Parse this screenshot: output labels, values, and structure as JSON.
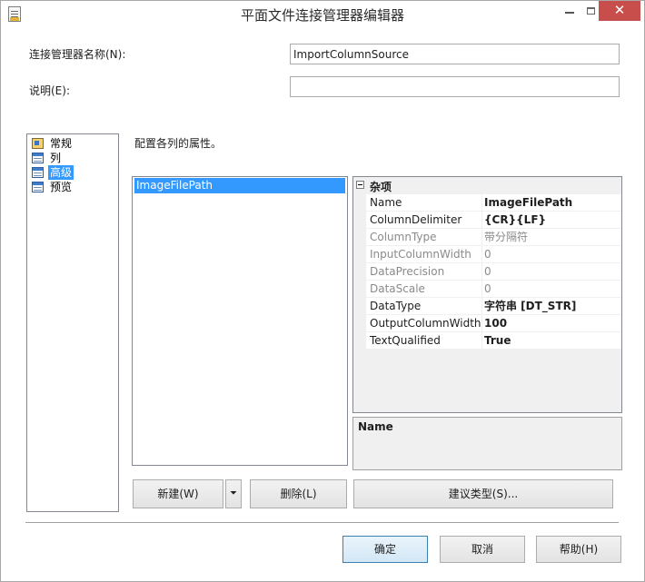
{
  "window": {
    "title": "平面文件连接管理器编辑器"
  },
  "titlebar": {
    "minimize_label": "",
    "maximize_label": "",
    "close_label": "✕"
  },
  "fields": {
    "name_label": "连接管理器名称(N):",
    "name_value": "ImportColumnSource",
    "desc_label": "说明(E):",
    "desc_value": ""
  },
  "nav": {
    "items": [
      {
        "label": "常规",
        "icon": "general-icon"
      },
      {
        "label": "列",
        "icon": "columns-icon"
      },
      {
        "label": "高级",
        "icon": "advanced-icon",
        "selected": true
      },
      {
        "label": "预览",
        "icon": "preview-icon"
      }
    ]
  },
  "main": {
    "instruction": "配置各列的属性。",
    "columns": [
      "ImageFilePath"
    ],
    "properties": {
      "category": "杂项",
      "toggle": "−",
      "rows": [
        {
          "name": "Name",
          "value": "ImageFilePath",
          "enabled": true,
          "bold": true
        },
        {
          "name": "ColumnDelimiter",
          "value": "{CR}{LF}",
          "enabled": true,
          "bold": true
        },
        {
          "name": "ColumnType",
          "value": "带分隔符",
          "enabled": false,
          "bold": false
        },
        {
          "name": "InputColumnWidth",
          "value": "0",
          "enabled": false,
          "bold": false
        },
        {
          "name": "DataPrecision",
          "value": "0",
          "enabled": false,
          "bold": false
        },
        {
          "name": "DataScale",
          "value": "0",
          "enabled": false,
          "bold": false
        },
        {
          "name": "DataType",
          "value": "字符串 [DT_STR]",
          "enabled": true,
          "bold": true
        },
        {
          "name": "OutputColumnWidth",
          "value": "100",
          "enabled": true,
          "bold": true
        },
        {
          "name": "TextQualified",
          "value": "True",
          "enabled": true,
          "bold": true
        }
      ]
    },
    "description_title": "Name"
  },
  "buttons": {
    "new": "新建(W)",
    "new_dropdown": "⏷",
    "delete": "删除(L)",
    "suggest": "建议类型(S)...",
    "ok": "确定",
    "cancel": "取消",
    "help": "帮助(H)"
  }
}
